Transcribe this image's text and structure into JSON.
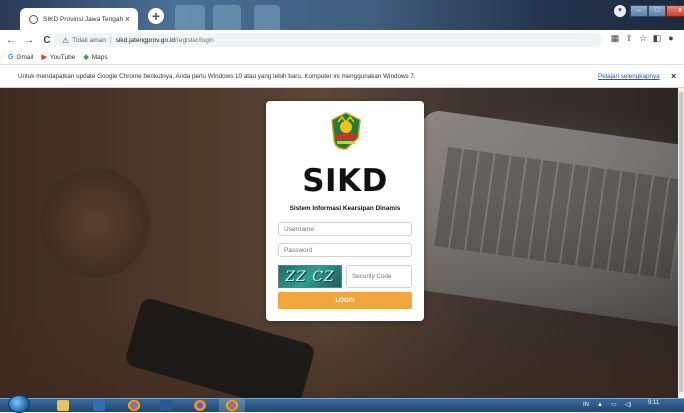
{
  "browser": {
    "tab_title": "SIKD Provinsi Jawa Tengah",
    "tab_close": "×",
    "new_tab": "+",
    "window_controls": [
      "▾",
      "–",
      "□",
      "x"
    ],
    "nav": {
      "back": "←",
      "forward": "→",
      "reload": "C"
    },
    "address": {
      "security_label": "Tidak aman",
      "domain": "sikd.jatengprov.go.id",
      "path": "/register/login"
    },
    "toolbar_icons": [
      "translate-icon",
      "share-icon",
      "star-icon",
      "sidepanel-icon",
      "profile-icon",
      "menu-icon"
    ],
    "bookmarks": [
      {
        "label": "Gmail",
        "icon": "G",
        "color": "#4285f4"
      },
      {
        "label": "YouTube",
        "icon": "▶",
        "color": "#e53935"
      },
      {
        "label": "Maps",
        "icon": "◆",
        "color": "#34a853"
      }
    ]
  },
  "infobar": {
    "message": "Untuk mendapatkan update Google Chrome berikutnya, Anda perlu Windows 10 atau yang lebih baru. Komputer ini menggunakan Windows 7.",
    "link": "Pelajari selengkapnya",
    "close": "×"
  },
  "login": {
    "brand": "SIKD",
    "subtitle": "Sistem Informasi Kearsipan Dinamis",
    "username_placeholder": "Username",
    "password_placeholder": "Password",
    "captcha_text": "ZZ CZ",
    "security_placeholder": "Security Code",
    "login_button": "LOGIN",
    "accent_color": "#f0a63c"
  },
  "taskbar": {
    "tray_lang": "IN",
    "clock": "9:11"
  }
}
